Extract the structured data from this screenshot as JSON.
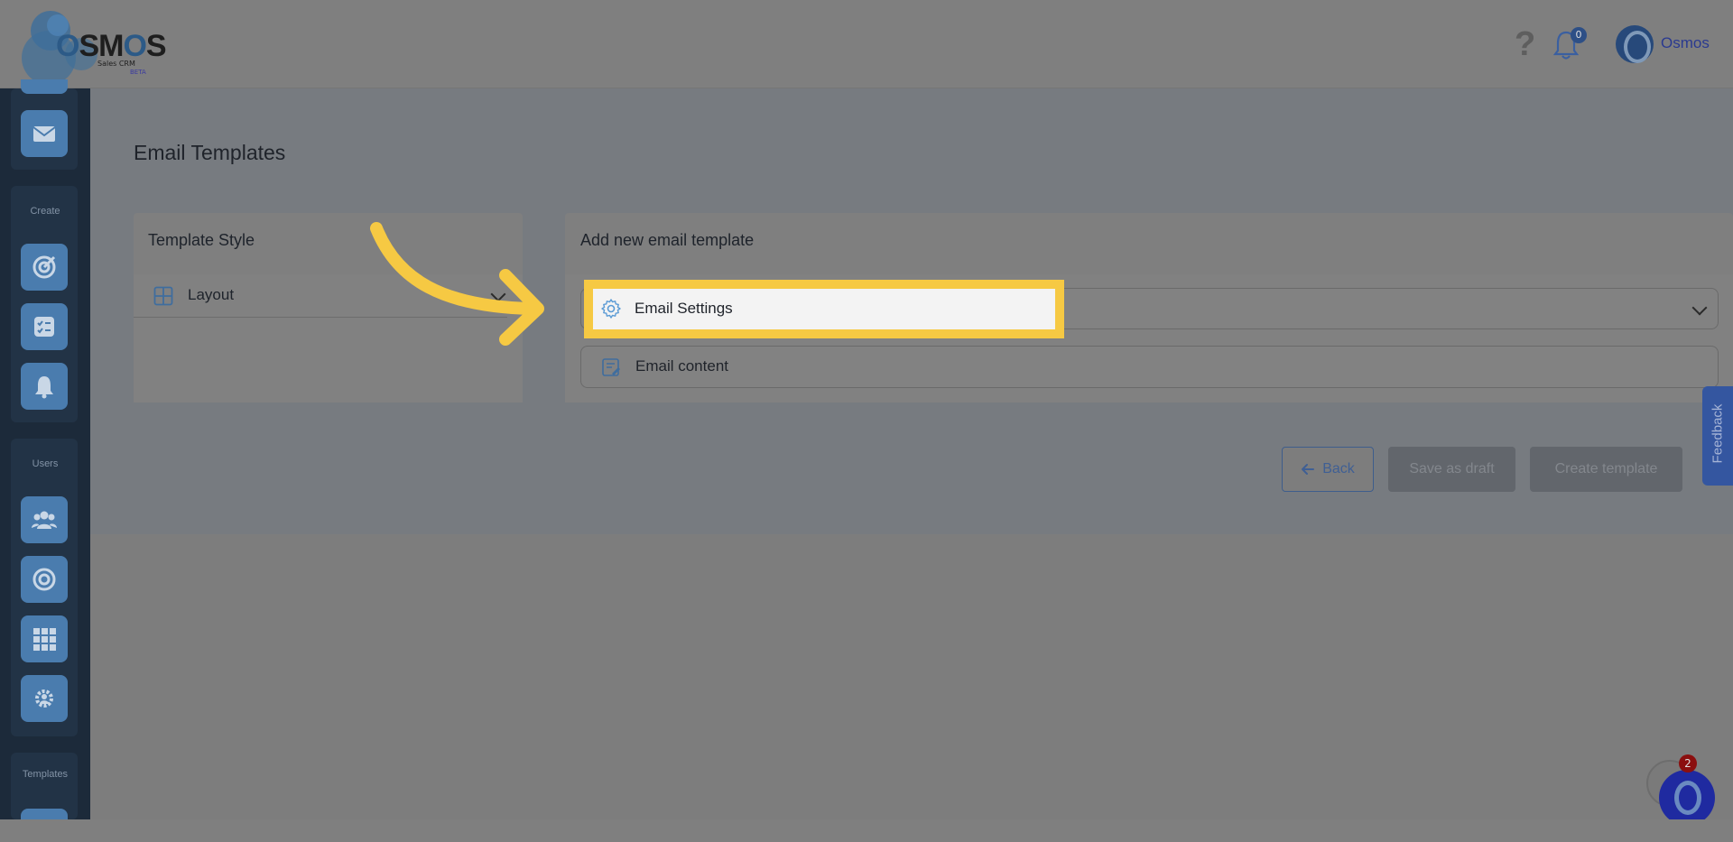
{
  "header": {
    "logo_text": "OSMOS",
    "logo_sub": "Sales CRM",
    "logo_beta": "BETA",
    "help_icon": "?",
    "notification_count": "0",
    "user_name": "Osmos"
  },
  "sidebar": {
    "sections": [
      {
        "label": "Create",
        "items": [
          "target-icon",
          "checklist-icon",
          "bell-icon"
        ]
      },
      {
        "label": "Users",
        "items": [
          "users-icon",
          "target-ring-icon",
          "grid-icon",
          "gear-group-icon"
        ]
      },
      {
        "label": "Templates",
        "items": []
      }
    ]
  },
  "page": {
    "title": "Email Templates"
  },
  "template_style": {
    "title": "Template Style",
    "layout_label": "Layout"
  },
  "new_template": {
    "title": "Add new email template",
    "email_settings_label": "Email Settings",
    "email_content_label": "Email content"
  },
  "actions": {
    "back_label": "Back",
    "draft_label": "Save as draft",
    "create_label": "Create template"
  },
  "feedback_label": "Feedback",
  "chat_badge": "2",
  "colors": {
    "highlight": "#f6c943",
    "accent": "#4a7cae",
    "sidebar": "#1c2a3a"
  }
}
